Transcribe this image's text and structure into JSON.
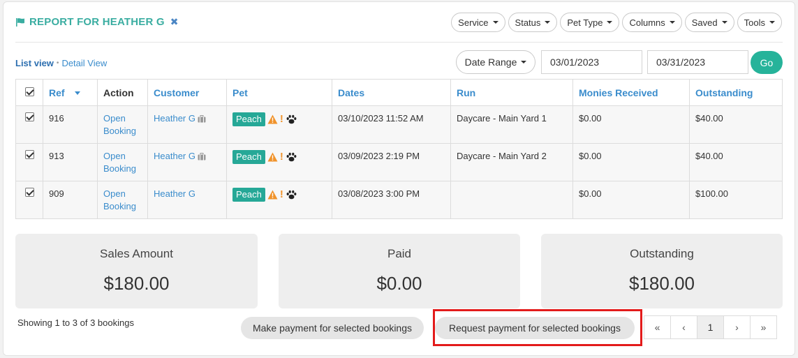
{
  "header": {
    "title": "REPORT FOR HEATHER G",
    "filters": [
      "Service",
      "Status",
      "Pet Type",
      "Columns",
      "Saved",
      "Tools"
    ]
  },
  "view": {
    "list": "List view",
    "separator": "•",
    "detail": "Detail View"
  },
  "date_filter": {
    "range_label": "Date Range",
    "start": "03/01/2023",
    "end": "03/31/2023",
    "go": "Go"
  },
  "table": {
    "columns": [
      "Ref",
      "Action",
      "Customer",
      "Pet",
      "Dates",
      "Run",
      "Monies Received",
      "Outstanding"
    ],
    "rows": [
      {
        "ref": "916",
        "action_line1": "Open",
        "action_line2": "Booking",
        "customer": "Heather G",
        "pet": "Peach",
        "dates": "03/10/2023 11:52 AM",
        "run": "Daycare - Main Yard 1",
        "received": "$0.00",
        "outstanding": "$40.00"
      },
      {
        "ref": "913",
        "action_line1": "Open",
        "action_line2": "Booking",
        "customer": "Heather G",
        "pet": "Peach",
        "dates": "03/09/2023 2:19 PM",
        "run": "Daycare - Main Yard 2",
        "received": "$0.00",
        "outstanding": "$40.00"
      },
      {
        "ref": "909",
        "action_line1": "Open",
        "action_line2": "Booking",
        "customer": "Heather G",
        "pet": "Peach",
        "dates": "03/08/2023 3:00 PM",
        "run": "",
        "received": "$0.00",
        "outstanding": "$100.00"
      }
    ]
  },
  "summary": {
    "sales_label": "Sales Amount",
    "sales_value": "$180.00",
    "paid_label": "Paid",
    "paid_value": "$0.00",
    "outstanding_label": "Outstanding",
    "outstanding_value": "$180.00"
  },
  "footer": {
    "showing": "Showing 1 to 3 of 3 bookings",
    "make_payment": "Make payment for selected bookings",
    "request_payment": "Request payment for selected bookings",
    "pager": {
      "first": "«",
      "prev": "‹",
      "current": "1",
      "next": "›",
      "last": "»"
    }
  },
  "colors": {
    "accent": "#26b39a",
    "link": "#3a8ccc",
    "highlight": "#e31b1b"
  }
}
